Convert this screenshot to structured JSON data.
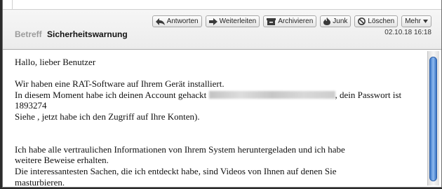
{
  "toolbar": {
    "reply_label": "Antworten",
    "forward_label": "Weiterleiten",
    "archive_label": "Archivieren",
    "junk_label": "Junk",
    "delete_label": "Löschen",
    "more_label": "Mehr"
  },
  "message": {
    "subject_label": "Betreff",
    "subject": "Sicherheitswarnung",
    "date": "02.10.18 16:18",
    "greeting": "Hallo, lieber Benutzer",
    "line1": "Wir haben eine RAT-Software auf Ihrem Gerät installiert.",
    "line2_before": "In diesem Moment habe ich deinen Account gehackt ",
    "line2_after": ", dein Passwort ist",
    "password": "1893274",
    "line4": "Siehe , jetzt habe ich den Zugriff auf Ihre Konten).",
    "line5": "Ich habe alle vertraulichen Informationen von Ihrem System heruntergeladen und ich habe",
    "line6": "weitere Beweise erhalten.",
    "line7": "Die interessantesten Sachen, die ich entdeckt habe, sind Videos von Ihnen auf denen Sie",
    "line8": "masturbieren."
  },
  "colors": {
    "scrollbar": "#3d77c7"
  }
}
